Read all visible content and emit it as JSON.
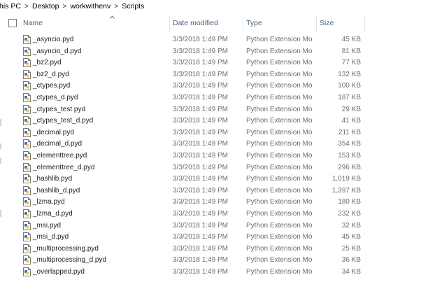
{
  "breadcrumb": {
    "items": [
      "his PC",
      "Desktop",
      "workwithenv",
      "Scripts"
    ],
    "separator": ">"
  },
  "header": {
    "columns": {
      "name": "Name",
      "date": "Date modified",
      "type": "Type",
      "size": "Size"
    },
    "sort_icon": "chevron-up-icon"
  },
  "files": [
    {
      "name": "_asyncio.pyd",
      "date": "3/3/2018 1:49 PM",
      "type": "Python Extension Mo...",
      "size": "45 KB"
    },
    {
      "name": "_asyncio_d.pyd",
      "date": "3/3/2018 1:49 PM",
      "type": "Python Extension Mo...",
      "size": "81 KB"
    },
    {
      "name": "_bz2.pyd",
      "date": "3/3/2018 1:49 PM",
      "type": "Python Extension Mo...",
      "size": "77 KB"
    },
    {
      "name": "_bz2_d.pyd",
      "date": "3/3/2018 1:49 PM",
      "type": "Python Extension Mo...",
      "size": "132 KB"
    },
    {
      "name": "_ctypes.pyd",
      "date": "3/3/2018 1:49 PM",
      "type": "Python Extension Mo...",
      "size": "100 KB"
    },
    {
      "name": "_ctypes_d.pyd",
      "date": "3/3/2018 1:49 PM",
      "type": "Python Extension Mo...",
      "size": "187 KB"
    },
    {
      "name": "_ctypes_test.pyd",
      "date": "3/3/2018 1:49 PM",
      "type": "Python Extension Mo...",
      "size": "29 KB"
    },
    {
      "name": "_ctypes_test_d.pyd",
      "date": "3/3/2018 1:49 PM",
      "type": "Python Extension Mo...",
      "size": "41 KB"
    },
    {
      "name": "_decimal.pyd",
      "date": "3/3/2018 1:49 PM",
      "type": "Python Extension Mo...",
      "size": "211 KB"
    },
    {
      "name": "_decimal_d.pyd",
      "date": "3/3/2018 1:49 PM",
      "type": "Python Extension Mo...",
      "size": "354 KB"
    },
    {
      "name": "_elementtree.pyd",
      "date": "3/3/2018 1:49 PM",
      "type": "Python Extension Mo...",
      "size": "153 KB"
    },
    {
      "name": "_elementtree_d.pyd",
      "date": "3/3/2018 1:49 PM",
      "type": "Python Extension Mo...",
      "size": "296 KB"
    },
    {
      "name": "_hashlib.pyd",
      "date": "3/3/2018 1:49 PM",
      "type": "Python Extension Mo...",
      "size": "1,019 KB"
    },
    {
      "name": "_hashlib_d.pyd",
      "date": "3/3/2018 1:49 PM",
      "type": "Python Extension Mo...",
      "size": "1,397 KB"
    },
    {
      "name": "_lzma.pyd",
      "date": "3/3/2018 1:49 PM",
      "type": "Python Extension Mo...",
      "size": "180 KB"
    },
    {
      "name": "_lzma_d.pyd",
      "date": "3/3/2018 1:49 PM",
      "type": "Python Extension Mo...",
      "size": "232 KB"
    },
    {
      "name": "_msi.pyd",
      "date": "3/3/2018 1:49 PM",
      "type": "Python Extension Mo...",
      "size": "32 KB"
    },
    {
      "name": "_msi_d.pyd",
      "date": "3/3/2018 1:49 PM",
      "type": "Python Extension Mo...",
      "size": "45 KB"
    },
    {
      "name": "_multiprocessing.pyd",
      "date": "3/3/2018 1:49 PM",
      "type": "Python Extension Mo...",
      "size": "25 KB"
    },
    {
      "name": "_multiprocessing_d.pyd",
      "date": "3/3/2018 1:49 PM",
      "type": "Python Extension Mo...",
      "size": "36 KB"
    },
    {
      "name": "_overlapped.pyd",
      "date": "3/3/2018 1:49 PM",
      "type": "Python Extension Mo...",
      "size": "34 KB"
    }
  ],
  "file_icon": "python-file-icon",
  "colors": {
    "header_text": "#4c607a",
    "detail_text": "#6d6d6d",
    "name_text": "#1e1e1e",
    "icon_blue": "#3d6fb6",
    "icon_yellow": "#f2c94c"
  }
}
